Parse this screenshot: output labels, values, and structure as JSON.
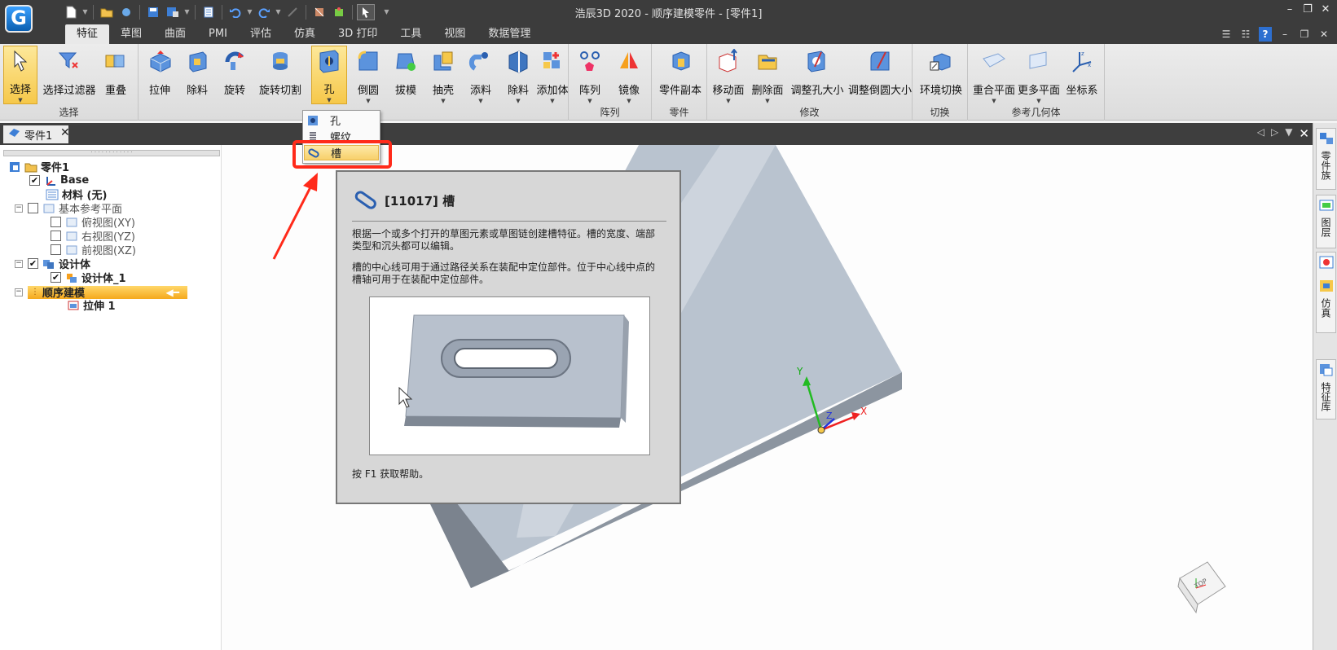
{
  "window": {
    "title": "浩辰3D 2020 - 顺序建模零件 - [零件1]",
    "logo_letter": "G"
  },
  "tabs": [
    {
      "label": "特征"
    },
    {
      "label": "草图"
    },
    {
      "label": "曲面"
    },
    {
      "label": "PMI"
    },
    {
      "label": "评估"
    },
    {
      "label": "仿真"
    },
    {
      "label": "3D 打印"
    },
    {
      "label": "工具"
    },
    {
      "label": "视图"
    },
    {
      "label": "数据管理"
    }
  ],
  "ribbon": {
    "select": {
      "select": "选择",
      "filter": "选择过滤器",
      "overlap": "重叠",
      "group": "选择"
    },
    "solids": {
      "extrude": "拉伸",
      "cut": "除料",
      "revolve": "旋转",
      "revolve_cut": "旋转切割",
      "hole": "孔",
      "round": "倒圆",
      "draft": "拔模",
      "shell": "抽壳",
      "add_material": "添料",
      "remove": "除料",
      "add_body": "添加体"
    },
    "pattern": {
      "pattern": "阵列",
      "mirror": "镜像",
      "group": "阵列"
    },
    "part": {
      "copy": "零件副本",
      "group": "零件"
    },
    "modify": {
      "move_face": "移动面",
      "delete_face": "删除面",
      "resize_hole": "调整孔大小",
      "resize_round": "调整倒圆大小",
      "group": "修改"
    },
    "switch": {
      "env_switch": "环境切换",
      "group": "切换"
    },
    "refgeo": {
      "coincident_plane": "重合平面",
      "more_planes": "更多平面",
      "coord_sys": "坐标系",
      "group": "参考几何体"
    }
  },
  "dropdown": {
    "items": [
      {
        "label": "孔"
      },
      {
        "label": "螺纹"
      },
      {
        "label": "槽"
      }
    ]
  },
  "doc_tab": {
    "label": "零件1",
    "close": "✕"
  },
  "tree": {
    "root": "零件1",
    "base": "Base",
    "material": "材料 (无)",
    "ref_planes": "基本参考平面",
    "top_view": "俯视图(XY)",
    "right_view": "右视图(YZ)",
    "front_view": "前视图(XZ)",
    "design_body": "设计体",
    "design_body_1": "设计体_1",
    "sequential": "顺序建模",
    "extrude_1": "拉伸 1"
  },
  "tooltip": {
    "title": "[11017] 槽",
    "para1": "根据一个或多个打开的草图元素或草图链创建槽特征。槽的宽度、端部类型和沉头都可以编辑。",
    "para2": "槽的中心线可用于通过路径关系在装配中定位部件。位于中心线中点的槽轴可用于在装配中定位部件。",
    "help": "按 F1 获取帮助。"
  },
  "axes": {
    "x": "X",
    "y": "Y",
    "z": "Z"
  },
  "viewcube": {
    "label": "TOP"
  },
  "right_panel": {
    "parts_lib": "零件族",
    "layers": "图层",
    "simulation": "仿真",
    "feature_lib": "特征库"
  },
  "colors": {
    "accent": "#f6c84a",
    "highlight": "#ff2a1a",
    "dark_bar": "#3c3c3c",
    "model": "#b9c3cf"
  }
}
